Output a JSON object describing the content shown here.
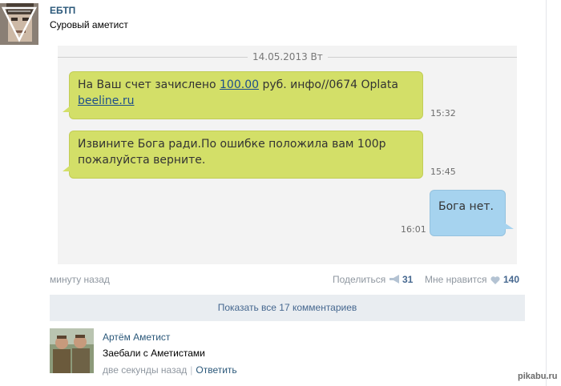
{
  "post": {
    "author": "ЕБТП",
    "text": "Суровый аметист",
    "time": "минуту назад",
    "share_label": "Поделиться",
    "share_count": "31",
    "like_label": "Мне нравится",
    "like_count": "140"
  },
  "sms": {
    "date": "14.05.2013 Вт",
    "messages": [
      {
        "part1": "На Ваш счет зачислено ",
        "amount_link": "100.00",
        "part2": " руб. инфо//0674 Oplata",
        "domain_link": "beeline.ru",
        "time": "15:32"
      },
      {
        "line1": "Извините Бога ради.По ошибке положила вам 100р",
        "line2": "пожалуйста верните.",
        "time": "15:45"
      },
      {
        "text": "Бога нет.",
        "time": "16:01"
      }
    ]
  },
  "comments_toggle": "Показать все 17 комментариев",
  "comment": {
    "author": "Артём Аметист",
    "text": "Заебали с Аметистами",
    "time": "две секунды назад",
    "separator": "|",
    "reply": "Ответить"
  },
  "watermark": "pikabu.ru",
  "colors": {
    "link": "#2b587a",
    "incoming_bubble": "#d3df68",
    "outgoing_bubble": "#a6d3ef",
    "button_bg": "#e9edf1"
  }
}
